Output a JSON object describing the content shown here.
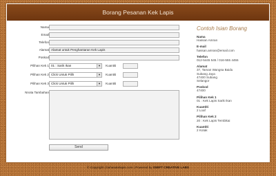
{
  "header": {
    "title": "Borang Pesanan Kek Lapis"
  },
  "form": {
    "nama_label": "Nama",
    "email_label": "Email",
    "telefon_label": "Telefon",
    "alamat_label": "Alamat",
    "alamat_value": "Alamat untuk Penghantaran Kek Lapis",
    "poskod_label": "Poskod",
    "pilihan1_label": "Pilihan Kek 1",
    "pilihan1_value": "01 : Sarik Ikan",
    "pilihan2_label": "Pilihan Kek 2",
    "pilihan2_value": "Click Untuk Pilih",
    "pilihan3_label": "Pilihan Kek 3",
    "pilihan3_value": "Click Untuk Pilih",
    "kuantiti_label": "Kuantiti",
    "nota_label": "Nnota Tambahan",
    "send_label": "Send"
  },
  "sidebar": {
    "title": "Contoh Isian Borang",
    "nama_h": "Nama",
    "nama_v": "Hassan Amran",
    "email_h": "E-mail",
    "email_v": "hassan.amran@email.com",
    "telefon_h": "Telefon",
    "telefon_v": "012-5445 545 / 016-555 4455",
    "alamat_h": "Alamat",
    "alamat_v1": "37, Taman Wangsa Baidu",
    "alamat_v2": "Subang Jaya",
    "alamat_v3": "47400 Subang",
    "alamat_v4": "Selangor",
    "poskod_h": "Poskod",
    "poskod_v": "47400",
    "pk1_h": "Pilihan Kek 1",
    "pk1_v": "01 : Kek Lapis Sarik Ikan",
    "kt1_h": "Kuantiti",
    "kt1_v": "2 Loaf",
    "pk2_h": "Pilihan Kek 2",
    "pk2_v": "20 : Kek Lapis Tembikai",
    "kt2_h": "Kuantiti",
    "kt2_v": "2 Kotak"
  },
  "footer": {
    "copyright": "© Copyright",
    "site": "bahasatelapis.com",
    "powered": "| Powered by",
    "brand": "SWIFT CREATIVE LABS"
  }
}
